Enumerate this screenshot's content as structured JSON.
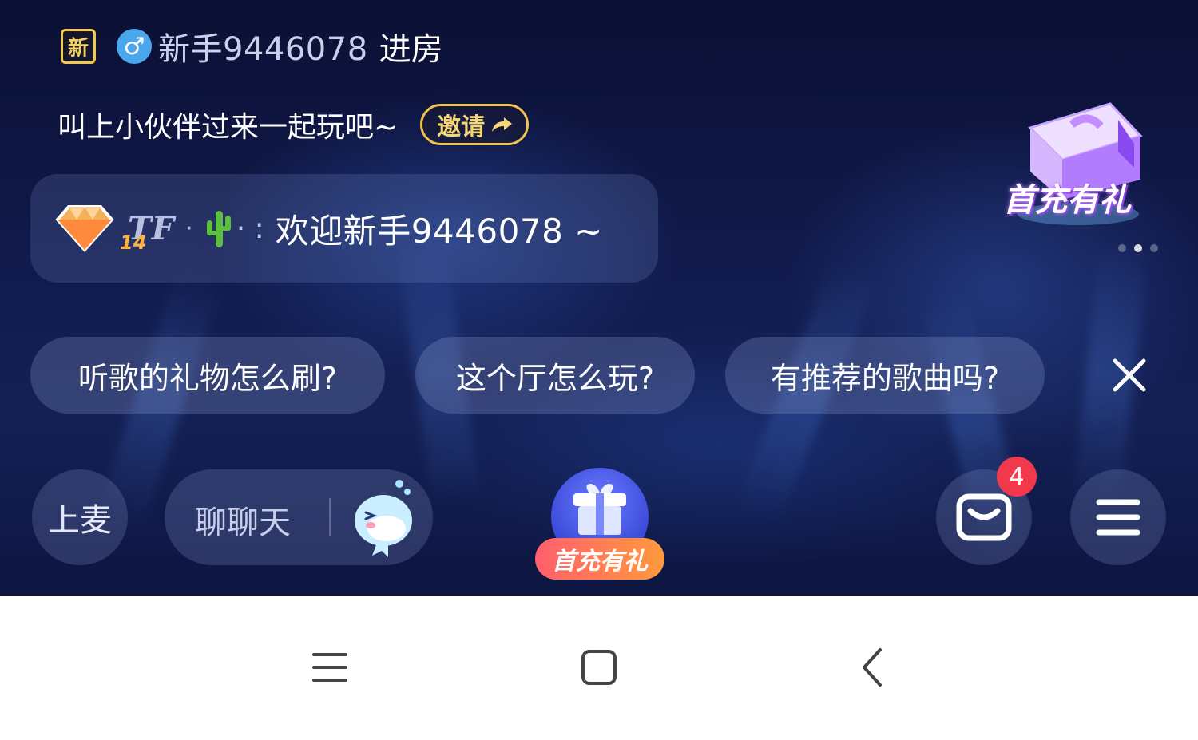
{
  "entry": {
    "badge": "新",
    "gender_icon": "male-icon",
    "gender_symbol": "♂",
    "username": "新手9446078",
    "action": "进房"
  },
  "invite": {
    "text": "叫上小伙伴过来一起玩吧~",
    "button_label": "邀请"
  },
  "welcome": {
    "level": "14",
    "tag": "TF",
    "dot": "·",
    "colon": "·  :",
    "message": "欢迎新手9446078 ~"
  },
  "promo": {
    "label": "首充有礼",
    "carousel_count": 3,
    "carousel_active": 2
  },
  "quick_questions": [
    "听歌的礼物怎么刷?",
    "这个厅怎么玩?",
    "有推荐的歌曲吗?"
  ],
  "toolbar": {
    "mic_label": "上麦",
    "chat_placeholder": "聊聊天",
    "gift_label": "首充有礼",
    "message_badge_count": "4"
  },
  "colors": {
    "accent_gold": "#f0c24a",
    "badge_red": "#f2394c",
    "gift_gradient_start": "#ff5f6d",
    "gift_gradient_end": "#ff9a3c",
    "background_dark": "#111a4c"
  }
}
